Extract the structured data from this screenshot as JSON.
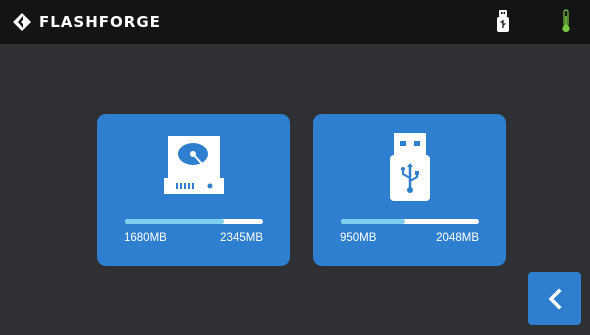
{
  "header": {
    "brand": "FLASHFORGE",
    "icons": {
      "logo": "flashforge-logo-icon",
      "usb_status": "usb-drive-status-icon",
      "temperature": "thermometer-icon"
    },
    "colors": {
      "usb_status": "#ffffff",
      "temperature": "#7ac943"
    }
  },
  "storage": [
    {
      "name": "internal-storage",
      "icon": "hard-drive-icon",
      "used": "1680MB",
      "total": "2345MB",
      "used_fraction": 0.716
    },
    {
      "name": "usb-storage",
      "icon": "usb-flash-drive-icon",
      "used": "950MB",
      "total": "2048MB",
      "used_fraction": 0.464
    }
  ],
  "footer": {
    "back_icon": "chevron-left-icon"
  },
  "colors": {
    "accent": "#2f7fd1",
    "background": "#2f3033",
    "topbar": "#141414",
    "progress_fill": "#7fd0ef"
  }
}
